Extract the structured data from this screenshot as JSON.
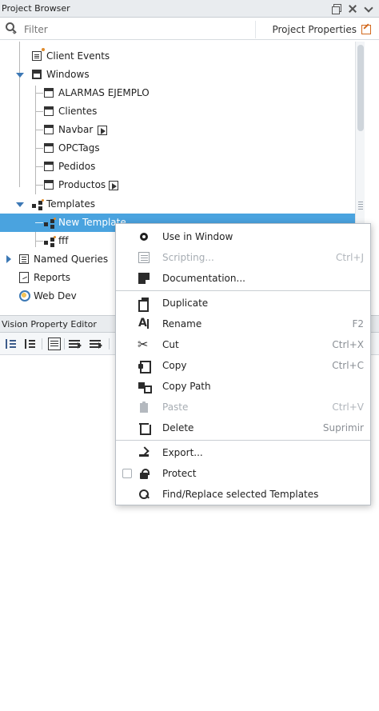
{
  "project_browser": {
    "title": "Project Browser",
    "filter_placeholder": "Filter",
    "project_properties_label": "Project Properties",
    "tree": [
      {
        "label": "Client Events",
        "icon": "client-events-icon"
      },
      {
        "label": "Windows",
        "icon": "windows-folder-icon"
      },
      {
        "label": "ALARMAS EJEMPLO",
        "icon": "window-icon"
      },
      {
        "label": "Clientes",
        "icon": "window-icon"
      },
      {
        "label": "Navbar",
        "icon": "window-icon"
      },
      {
        "label": "OPCTags",
        "icon": "window-icon"
      },
      {
        "label": "Pedidos",
        "icon": "window-icon"
      },
      {
        "label": "Productos",
        "icon": "window-icon"
      },
      {
        "label": "Templates",
        "icon": "templates-icon"
      },
      {
        "label": "New Template",
        "icon": "template-icon"
      },
      {
        "label": "fff",
        "icon": "template-icon"
      },
      {
        "label": "Named Queries",
        "icon": "named-queries-icon"
      },
      {
        "label": "Reports",
        "icon": "reports-icon"
      },
      {
        "label": "Web Dev",
        "icon": "web-dev-icon"
      }
    ]
  },
  "vision_property_editor": {
    "title": "Vision Property Editor"
  },
  "context_menu": {
    "items": [
      {
        "label": "Use in Window",
        "shortcut": "",
        "enabled": true,
        "icon": "move-icon"
      },
      {
        "label": "Scripting...",
        "shortcut": "Ctrl+J",
        "enabled": false,
        "icon": "script-icon"
      },
      {
        "label": "Documentation...",
        "shortcut": "",
        "enabled": true,
        "icon": "documentation-icon"
      },
      {
        "label": "Duplicate",
        "shortcut": "",
        "enabled": true,
        "icon": "duplicate-icon"
      },
      {
        "label": "Rename",
        "shortcut": "F2",
        "enabled": true,
        "icon": "rename-icon"
      },
      {
        "label": "Cut",
        "shortcut": "Ctrl+X",
        "enabled": true,
        "icon": "cut-icon"
      },
      {
        "label": "Copy",
        "shortcut": "Ctrl+C",
        "enabled": true,
        "icon": "copy-icon"
      },
      {
        "label": "Copy Path",
        "shortcut": "",
        "enabled": true,
        "icon": "copy-path-icon"
      },
      {
        "label": "Paste",
        "shortcut": "Ctrl+V",
        "enabled": false,
        "icon": "paste-icon"
      },
      {
        "label": "Delete",
        "shortcut": "Suprimir",
        "enabled": true,
        "icon": "delete-icon"
      },
      {
        "label": "Export...",
        "shortcut": "",
        "enabled": true,
        "icon": "export-icon"
      },
      {
        "label": "Protect",
        "shortcut": "",
        "enabled": true,
        "icon": "lock-icon"
      },
      {
        "label": "Find/Replace selected Templates",
        "shortcut": "",
        "enabled": true,
        "icon": "find-replace-icon"
      }
    ]
  },
  "colors": {
    "selection": "#4aa3df",
    "header_bg": "#e9ecef",
    "accent": "#3c78b5"
  }
}
